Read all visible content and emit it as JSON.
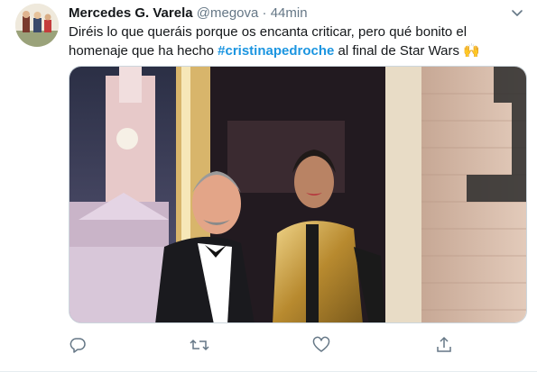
{
  "tweet": {
    "author_name": "Mercedes G. Varela",
    "author_handle": "@megova",
    "separator": "·",
    "time": "44min",
    "text_line1": "Diréis lo que queráis porque os encanta criticar, pero qué bonito el",
    "text_line2_before": "homenaje que ha hecho ",
    "hashtag": "#cristinapedroche",
    "text_line2_after": " al final de Star Wars ",
    "emoji": "🙌"
  },
  "actions": {
    "icons": [
      "reply-icon",
      "retweet-icon",
      "like-icon",
      "share-icon"
    ]
  },
  "colors": {
    "accent": "#1b95e0",
    "secondary_text": "#657786",
    "icon": "#657786",
    "gold": "#c9a64a"
  }
}
